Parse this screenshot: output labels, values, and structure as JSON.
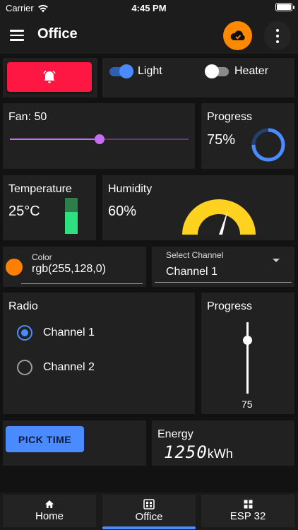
{
  "status_bar": {
    "carrier": "Carrier",
    "time": "4:45 PM"
  },
  "app_bar": {
    "title": "Office"
  },
  "switches": [
    {
      "label": "Light",
      "on": true
    },
    {
      "label": "Heater",
      "on": false
    }
  ],
  "fan": {
    "label": "Fan: 50",
    "value": 50,
    "max": 100,
    "color": "#c66ef0"
  },
  "progress_ring": {
    "label": "Progress",
    "value_text": "75%",
    "fraction": 0.75,
    "color": "#4a8cff"
  },
  "temperature": {
    "label": "Temperature",
    "value_text": "25°C",
    "level_fraction": 0.6
  },
  "humidity": {
    "label": "Humidity",
    "value_text": "60%",
    "fraction": 0.6,
    "gauge_color": "#ffd21f"
  },
  "color_field": {
    "label": "Color",
    "value": "rgb(255,128,0)",
    "swatch": "#ff8000"
  },
  "channel_select": {
    "label": "Select Channel",
    "value": "Channel 1"
  },
  "radio": {
    "title": "Radio",
    "options": [
      {
        "label": "Channel 1",
        "checked": true
      },
      {
        "label": "Channel 2",
        "checked": false
      }
    ]
  },
  "vertical_progress": {
    "label": "Progress",
    "value_text": "75",
    "fraction": 0.75
  },
  "pick_time": {
    "label": "PICK TIME"
  },
  "energy": {
    "label": "Energy",
    "value": "1250",
    "unit": "kWh"
  },
  "bottom_nav": [
    {
      "label": "Home",
      "icon": "home-icon",
      "active": false
    },
    {
      "label": "Office",
      "icon": "office-icon",
      "active": true
    },
    {
      "label": "ESP 32",
      "icon": "grid-icon",
      "active": false
    }
  ],
  "colors": {
    "accent": "#4a8cff",
    "alarm": "#ff1744",
    "cloud": "#ff8a00",
    "card": "#212121",
    "background": "#121212"
  }
}
